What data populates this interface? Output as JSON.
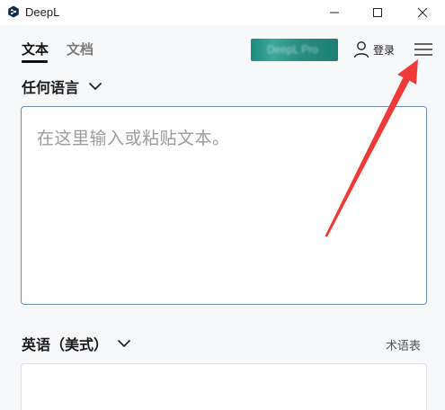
{
  "window": {
    "title": "DeepL",
    "icons": {
      "logo": "deepl-logo-icon",
      "minimize": "minimize-icon",
      "maximize": "maximize-icon",
      "close": "close-icon"
    }
  },
  "toolbar": {
    "tabs": [
      {
        "label": "文本",
        "active": true
      },
      {
        "label": "文档",
        "active": false
      }
    ],
    "promo_label": "DeepL Pro",
    "login_label": "登录",
    "icons": {
      "user": "user-icon",
      "menu": "hamburger-menu-icon"
    }
  },
  "source": {
    "language": "任何语言",
    "placeholder": "在这里输入或粘贴文本。"
  },
  "target": {
    "language": "英语（美式）",
    "glossary_label": "术语表"
  },
  "annotation": {
    "color": "#f03a3a",
    "icon": "red-arrow-annotation"
  },
  "colors": {
    "accent": "#1f8a80",
    "text": "#1a1a1a",
    "muted": "#9c9c9c",
    "border_active": "#6a8ab8"
  }
}
